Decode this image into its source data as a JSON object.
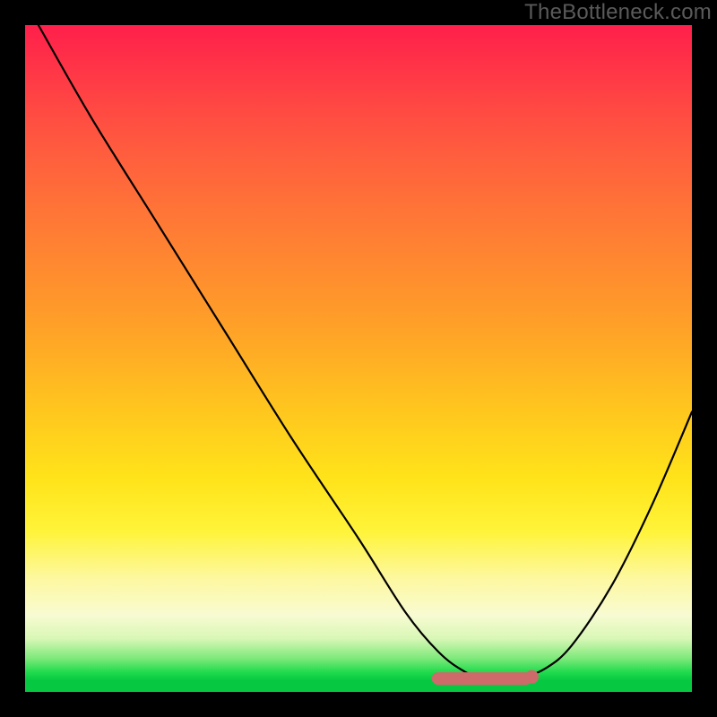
{
  "watermark": "TheBottleneck.com",
  "chart_data": {
    "type": "line",
    "title": "",
    "xlabel": "",
    "ylabel": "",
    "xlim": [
      0,
      100
    ],
    "ylim": [
      0,
      100
    ],
    "grid": false,
    "legend": false,
    "series": [
      {
        "name": "bottleneck-curve",
        "x": [
          2,
          10,
          20,
          30,
          40,
          50,
          57,
          62,
          66,
          70,
          74,
          78,
          82,
          88,
          94,
          100
        ],
        "values": [
          100,
          86,
          70,
          54,
          38,
          23,
          12,
          6,
          3,
          1.5,
          2,
          3.5,
          7,
          16,
          28,
          42
        ]
      }
    ],
    "highlight_range": {
      "x_start": 61,
      "x_end": 76,
      "y": 2
    },
    "highlight_color": "#cf6a6a",
    "background_gradient": {
      "top": "#ff1f4b",
      "mid": "#ffe31a",
      "bottom": "#06c941"
    }
  }
}
